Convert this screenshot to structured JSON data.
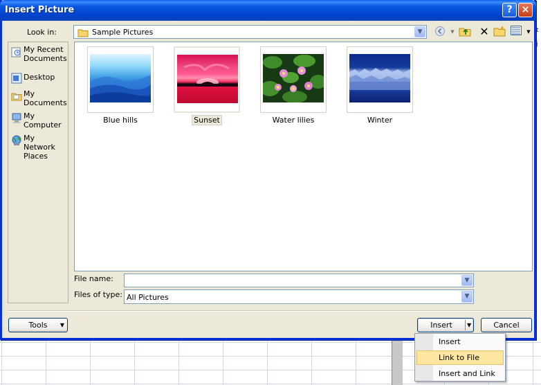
{
  "window": {
    "title": "Insert Picture",
    "help_label": "?",
    "close_label": "×"
  },
  "look_in": {
    "label": "Look in:",
    "value": "Sample Pictures",
    "icon": "folder-icon"
  },
  "toolbar": {
    "icons": [
      "back-icon",
      "up-one-level-icon",
      "delete-icon",
      "new-folder-icon",
      "views-icon"
    ]
  },
  "places": [
    {
      "label": "My Recent Documents",
      "icon": "recent-documents-icon"
    },
    {
      "label": "Desktop",
      "icon": "desktop-icon"
    },
    {
      "label": "My Documents",
      "icon": "my-documents-icon"
    },
    {
      "label": "My Computer",
      "icon": "my-computer-icon"
    },
    {
      "label": "My Network Places",
      "icon": "network-places-icon"
    }
  ],
  "files": [
    {
      "name": "Blue hills",
      "selected": false
    },
    {
      "name": "Sunset",
      "selected": true
    },
    {
      "name": "Water lilies",
      "selected": false
    },
    {
      "name": "Winter",
      "selected": false
    }
  ],
  "file_name": {
    "label": "File name:",
    "value": ""
  },
  "file_type": {
    "label": "Files of type:",
    "value": "All Pictures"
  },
  "buttons": {
    "tools": "Tools",
    "insert": "Insert",
    "cancel": "Cancel"
  },
  "insert_menu": {
    "items": [
      {
        "label": "Insert",
        "highlighted": false
      },
      {
        "label": "Link to File",
        "highlighted": true
      },
      {
        "label": "Insert and Link",
        "highlighted": false
      }
    ]
  },
  "background": {
    "edge_ticks": [
      "t",
      "j"
    ]
  }
}
